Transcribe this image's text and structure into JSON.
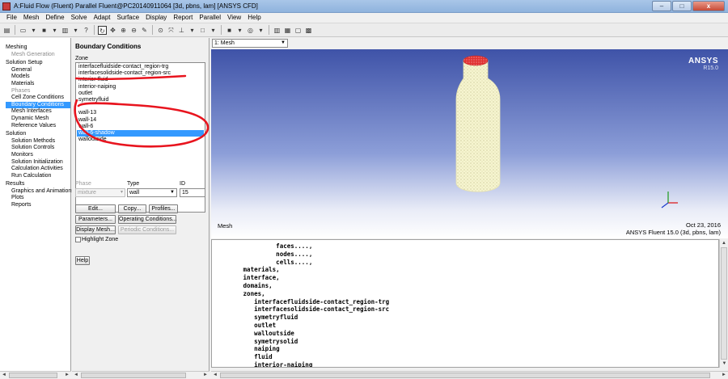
{
  "window": {
    "title": "A:Fluid Flow (Fluent) Parallel Fluent@PC20140911064  [3d, pbns, lam] [ANSYS CFD]",
    "minimize": "–",
    "maximize": "□",
    "close": "x"
  },
  "menu": [
    "File",
    "Mesh",
    "Define",
    "Solve",
    "Adapt",
    "Surface",
    "Display",
    "Report",
    "Parallel",
    "View",
    "Help"
  ],
  "tree": {
    "groups": [
      {
        "label": "Meshing",
        "items": [
          {
            "label": "Mesh Generation",
            "dim": true
          }
        ]
      },
      {
        "label": "Solution Setup",
        "items": [
          {
            "label": "General"
          },
          {
            "label": "Models"
          },
          {
            "label": "Materials"
          },
          {
            "label": "Phases",
            "dim": true
          },
          {
            "label": "Cell Zone Conditions"
          },
          {
            "label": "Boundary Conditions",
            "selected": true
          },
          {
            "label": "Mesh Interfaces"
          },
          {
            "label": "Dynamic Mesh"
          },
          {
            "label": "Reference Values"
          }
        ]
      },
      {
        "label": "Solution",
        "items": [
          {
            "label": "Solution Methods"
          },
          {
            "label": "Solution Controls"
          },
          {
            "label": "Monitors"
          },
          {
            "label": "Solution Initialization"
          },
          {
            "label": "Calculation Activities"
          },
          {
            "label": "Run Calculation"
          }
        ]
      },
      {
        "label": "Results",
        "items": [
          {
            "label": "Graphics and Animations"
          },
          {
            "label": "Plots"
          },
          {
            "label": "Reports"
          }
        ]
      }
    ]
  },
  "bc": {
    "title": "Boundary Conditions",
    "zone_label": "Zone",
    "zones": [
      {
        "label": "interfacefluidside-contact_region-trg"
      },
      {
        "label": "interfacesolidside-contact_region-src"
      },
      {
        "label": "interior-fluid"
      },
      {
        "label": "interior-naiping"
      },
      {
        "label": "outlet"
      },
      {
        "label": "symetryfluid"
      },
      {
        "label": ""
      },
      {
        "label": "wall-13"
      },
      {
        "label": "wall-14"
      },
      {
        "label": "wall-6"
      },
      {
        "label": "wall-6-shadow",
        "selected": true
      },
      {
        "label": "walloutside"
      }
    ],
    "phase_label": "Phase",
    "phase_value": "mixture",
    "type_label": "Type",
    "type_value": "wall",
    "id_label": "ID",
    "id_value": "15",
    "buttons": {
      "edit": "Edit...",
      "copy": "Copy...",
      "profiles": "Profiles...",
      "parameters": "Parameters...",
      "operating": "Operating Conditions...",
      "display_mesh": "Display Mesh...",
      "periodic": "Periodic Conditions...",
      "help": "Help"
    },
    "highlight_zone": "Highlight Zone",
    "annotation_color": "#e8141e"
  },
  "graphics": {
    "view_select": "1: Mesh",
    "brand": "ANSYS",
    "version": "R15.0",
    "caption": "Mesh",
    "date": "Oct 23, 2016",
    "product": "ANSYS Fluent 15.0 (3d, pbns, lam)"
  },
  "console": {
    "lines": [
      "            faces....,",
      "            nodes....,",
      "            cells....,",
      "   materials,",
      "   interface,",
      "   domains,",
      "   zones,",
      "      interfacefluidside-contact_region-trg",
      "      interfacesolidside-contact_region-src",
      "      symetryfluid",
      "      outlet",
      "      walloutside",
      "      symetrysolid",
      "      naiping",
      "      fluid",
      "      interior-naiping"
    ]
  },
  "scroll": {
    "left": "◄",
    "right": "►",
    "up": "▲",
    "down": "▼"
  }
}
